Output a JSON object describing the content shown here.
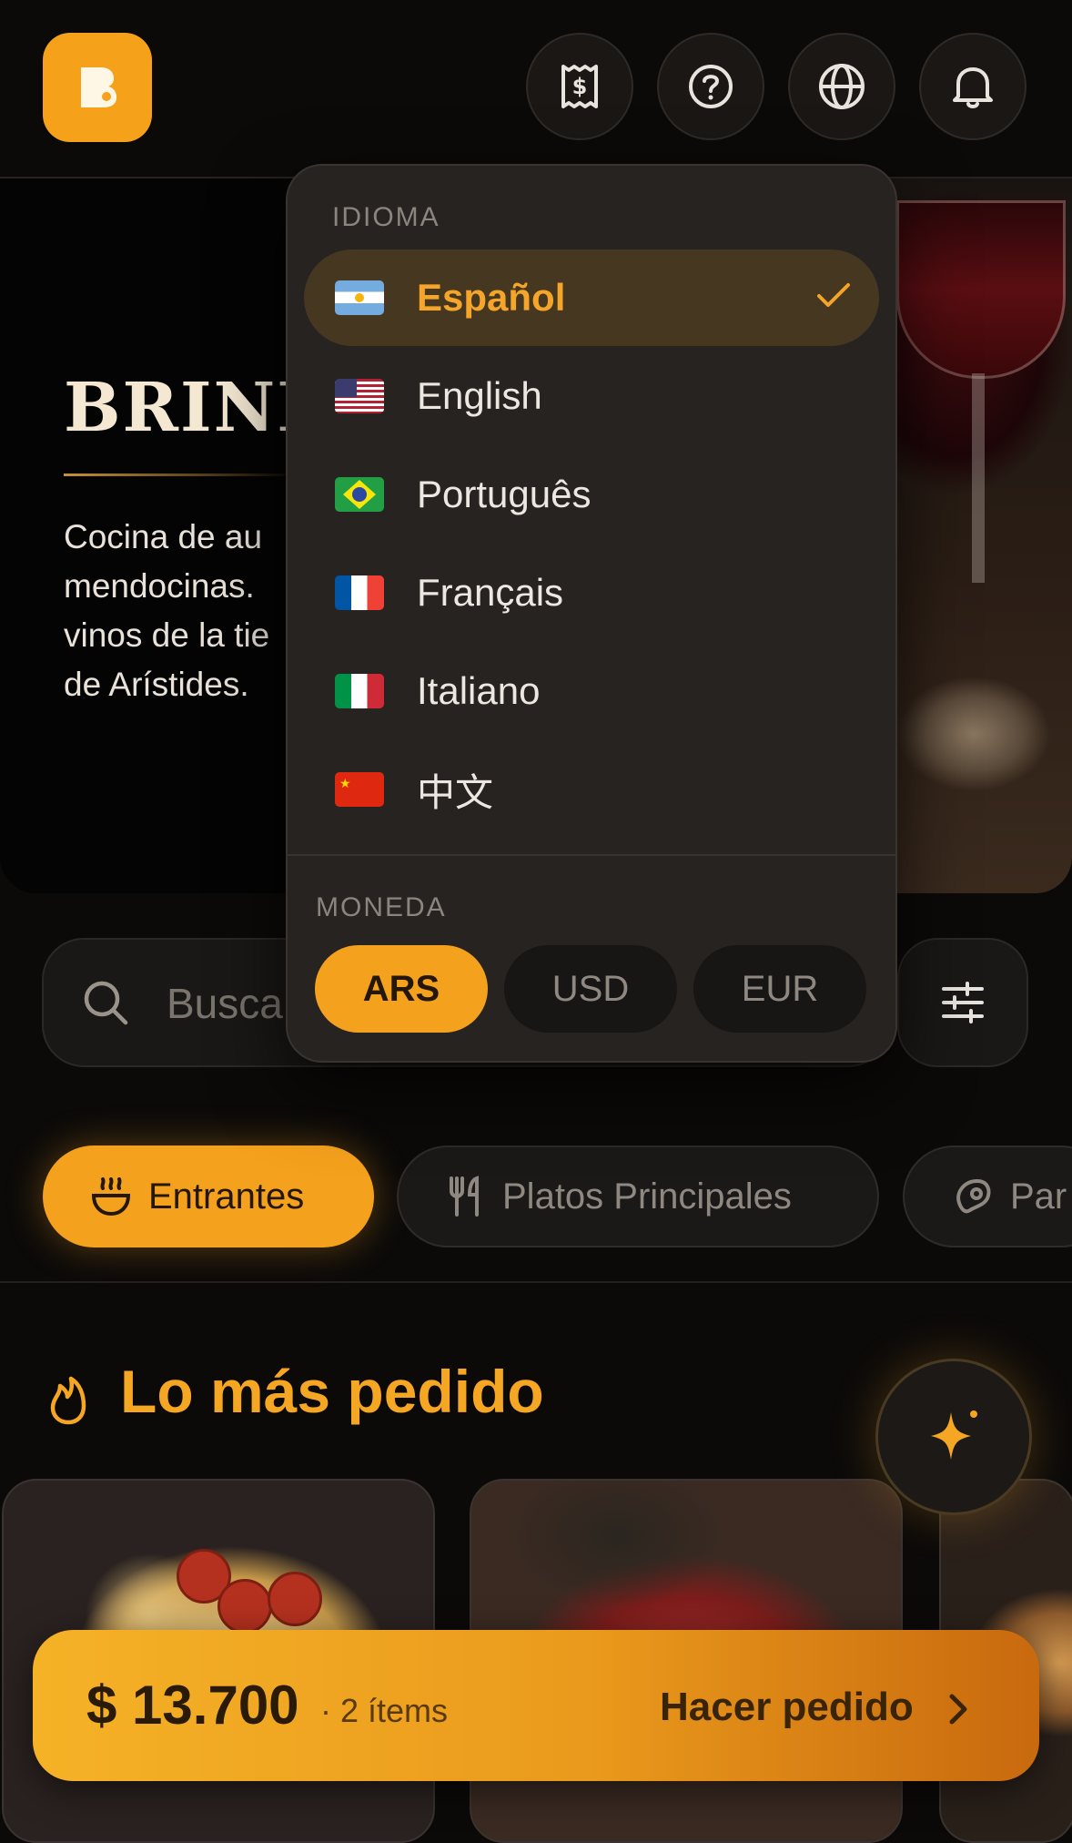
{
  "header": {
    "logo_letter": "B",
    "buttons": [
      {
        "name": "receipt-icon",
        "label": ""
      },
      {
        "name": "help-icon",
        "label": ""
      },
      {
        "name": "globe-icon",
        "label": ""
      },
      {
        "name": "bell-icon",
        "label": ""
      }
    ]
  },
  "hero": {
    "title": "BRIND",
    "description": "Cocina de au\nmendocinas.\nvinos de la tie\nde Arístides."
  },
  "search": {
    "placeholder": "Busca"
  },
  "categories": [
    {
      "label": "Entrantes",
      "icon": "pot-icon",
      "active": true
    },
    {
      "label": "Platos Principales",
      "icon": "cutlery-icon",
      "active": false
    },
    {
      "label": "Par",
      "icon": "meat-icon",
      "active": false
    }
  ],
  "section": {
    "title": "Lo más pedido"
  },
  "order": {
    "total": "$ 13.700",
    "items": "· 2 ítems",
    "action": "Hacer pedido"
  },
  "dropdown": {
    "language_heading": "IDIOMA",
    "languages": [
      {
        "label": "Español",
        "selected": true,
        "flag": "ar"
      },
      {
        "label": "English",
        "selected": false,
        "flag": "us"
      },
      {
        "label": "Português",
        "selected": false,
        "flag": "br"
      },
      {
        "label": "Français",
        "selected": false,
        "flag": "fr"
      },
      {
        "label": "Italiano",
        "selected": false,
        "flag": "it"
      },
      {
        "label": "中文",
        "selected": false,
        "flag": "cn"
      }
    ],
    "currency_heading": "MONEDA",
    "currencies": [
      {
        "label": "ARS",
        "selected": true
      },
      {
        "label": "USD",
        "selected": false
      },
      {
        "label": "EUR",
        "selected": false
      }
    ]
  },
  "colors": {
    "accent": "#f4a11d",
    "background": "#0c0a09",
    "panel": "#272321"
  }
}
